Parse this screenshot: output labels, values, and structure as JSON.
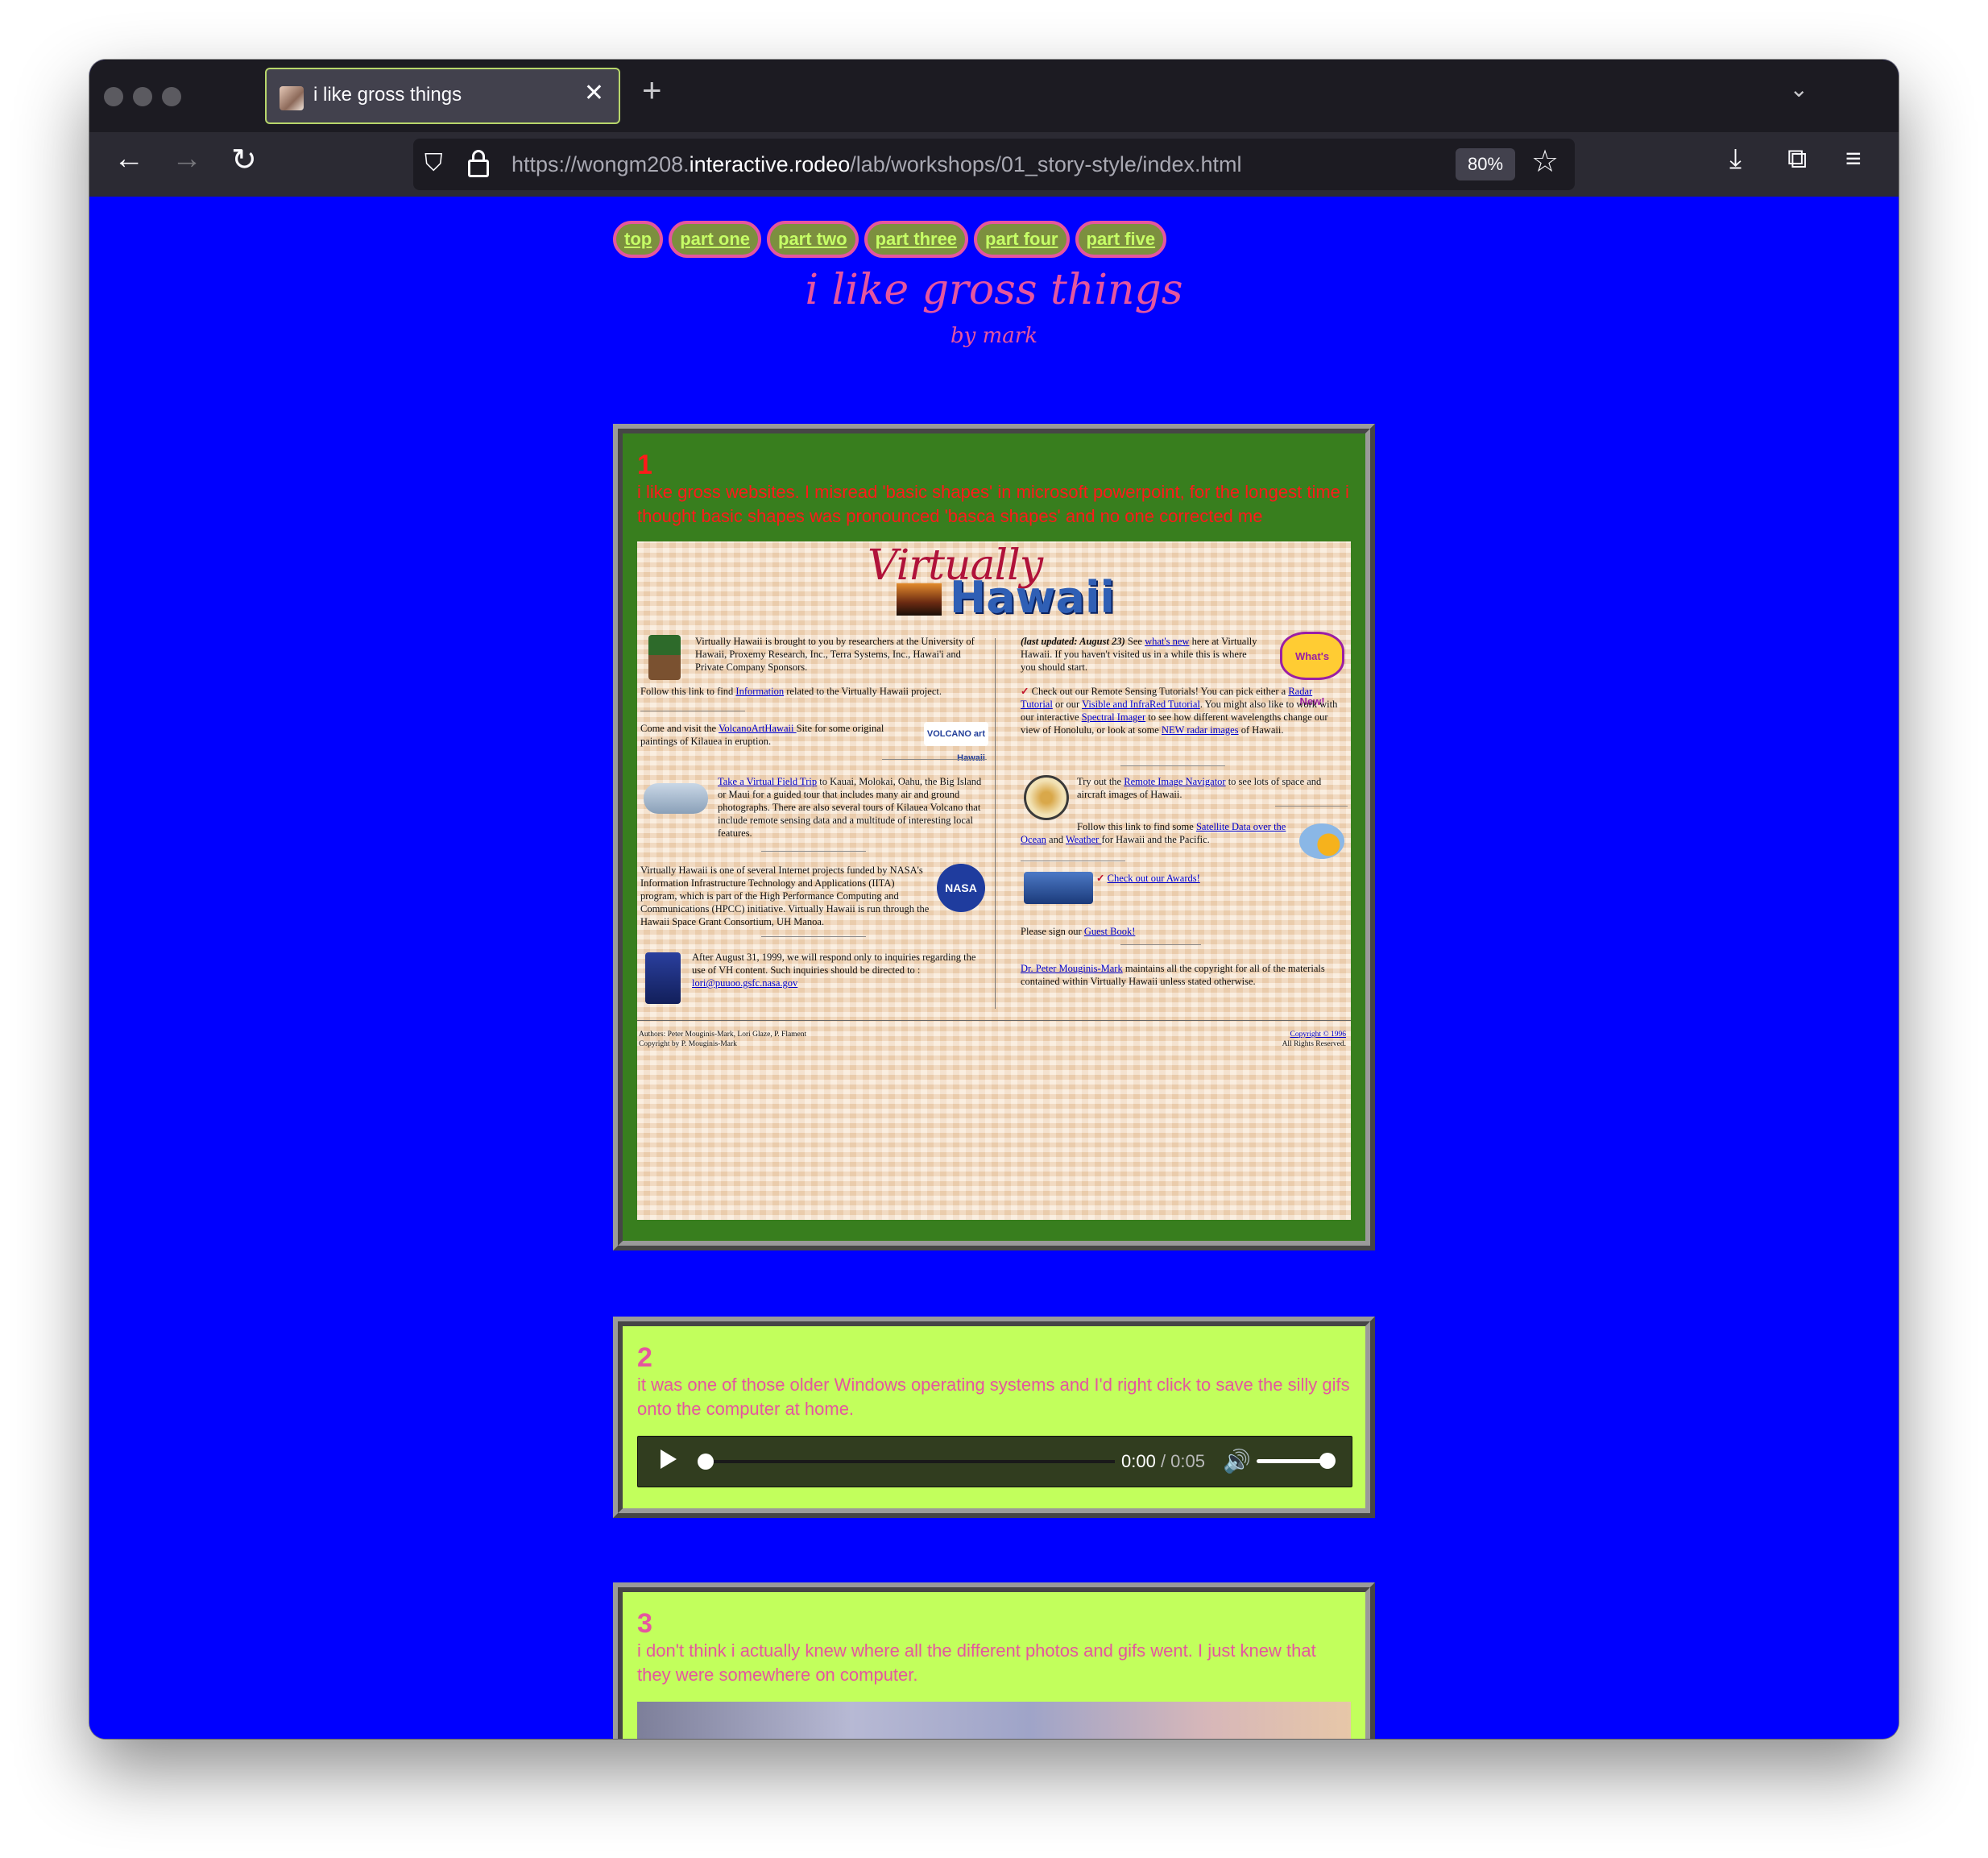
{
  "browser": {
    "tab_title": "i like gross things",
    "tab_close": "✕",
    "new_tab": "+",
    "tab_list": "⌄",
    "url_prefix": "https://wongm208.",
    "url_domain": "interactive.rodeo",
    "url_path": "/lab/workshops/01_story-style/index.html",
    "zoom": "80%",
    "back": "←",
    "forward": "→",
    "reload": "↻",
    "shield": "⛉",
    "star": "☆",
    "download": "⤓",
    "extensions": "⧉",
    "menu": "≡"
  },
  "nav": {
    "items": [
      {
        "label": "top"
      },
      {
        "label": "part one"
      },
      {
        "label": "part two"
      },
      {
        "label": "part three"
      },
      {
        "label": "part four"
      },
      {
        "label": "part five"
      }
    ]
  },
  "header": {
    "title": "i like gross things",
    "byline": "by mark"
  },
  "sections": [
    {
      "number": "1",
      "text": "i like gross websites. I misread 'basic shapes' in microsoft powerpoint, for the longest time i thought basic shapes was pronounced 'basca shapes' and no one corrected me"
    },
    {
      "number": "2",
      "text": "it was one of those older Windows operating systems and I'd right click to save the silly gifs onto the computer at home."
    },
    {
      "number": "3",
      "text": "i don't think i actually knew where all the different photos and gifs went. I just knew that they were somewhere on computer."
    }
  ],
  "audio": {
    "current": "0:00",
    "total": " / 0:05",
    "volume_icon": "🔊",
    "progress": 0,
    "volume": 1.0
  },
  "vh": {
    "title1": "Virtually",
    "title2": "Hawaii",
    "p1": "Virtually Hawaii is brought to you by researchers at the University of Hawaii, Proxemy Research, Inc., Terra Systems, Inc., Hawai'i and Private Company Sponsors.",
    "p2a": "Follow this link to find ",
    "p2link": "Information",
    "p2b": " related to the Virtually Hawaii project.",
    "p3a": "Come and visit the ",
    "p3link": "VolcanoArtHawaii ",
    "p3b": "Site for some original paintings of Kilauea in eruption.",
    "p4link": "Take a Virtual Field Trip",
    "p4b": " to Kauai, Molokai, Oahu, the Big Island or Maui for a guided tour that includes many air and ground photographs. There are also several tours of Kilauea Volcano that include remote sensing data and a multitude of interesting local features.",
    "p5": "Virtually Hawaii is one of several Internet projects funded by NASA's Information Infrastructure Technology and Applications (IITA) program, which is part of the High Performance Computing and Communications (HPCC) initiative. Virtually Hawaii is run through the Hawaii Space Grant Consortium, UH Manoa.",
    "p6": "After August 31, 1999, we will respond only to inquiries regarding the use of VH content. Such inquiries should be directed to :",
    "p6link": "lori@puuoo.gsfc.nasa.gov",
    "r1a": "(last updated: August 23)",
    "r1b": " See ",
    "r1link": "what's new",
    "r1c": " here at Virtually Hawaii. If you haven't visited us in a while this is where you should start.",
    "r2a": "Check out our Remote Sensing Tutorials! You can pick either a ",
    "r2link1": "Radar Tutorial",
    "r2b": " or our ",
    "r2link2": "Visible and InfraRed Tutorial",
    "r2c": ". You might also like to work with our interactive ",
    "r2link3": "Spectral Imager",
    "r2d": " to see how different wavelengths change our view of Honolulu, or look at some ",
    "r2link4": "NEW radar images",
    "r2e": " of Hawaii.",
    "r3a": "Try out the ",
    "r3link": "Remote Image Navigator",
    "r3b": " to see lots of space and aircraft images of Hawaii.",
    "r4a": "Follow this link to find some ",
    "r4link1": "Satellite Data over the Ocean",
    "r4b": " and ",
    "r4link2": "Weather ",
    "r4c": "for Hawaii and the Pacific.",
    "r5link": "Check out our Awards!",
    "r6a": "Please sign our ",
    "r6link": "Guest Book!",
    "r7link": "Dr. Peter Mouginis-Mark",
    "r7b": " maintains all the copyright for all of the materials contained within Virtually Hawaii unless stated otherwise.",
    "foot_left1": "Authors: Peter Mouginis-Mark, Lori Glaze, P. Flament",
    "foot_left2": "Copyright by P. Mouginis-Mark",
    "foot_right1": "Copyright © 1996",
    "foot_right2": "All Rights Reserved.",
    "whats_new_badge": "What's New!",
    "volcano_art_badge": "VOLCANO art Hawaii",
    "nasa_badge": "NASA"
  },
  "colors": {
    "page_bg": "#0000ff",
    "accent_pink": "#e5569f",
    "card1_bg": "#387e1e",
    "card_lime": "#c2ff5c",
    "card1_text": "#ff1a1a"
  }
}
